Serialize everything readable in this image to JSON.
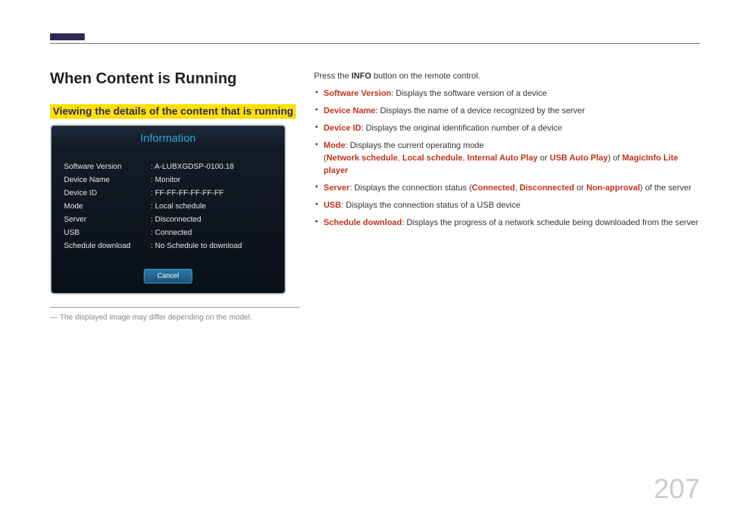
{
  "headings": {
    "h1": "When Content is Running",
    "h2": "Viewing the details of the content that is running"
  },
  "panel": {
    "title": "Information",
    "rows": [
      {
        "k": "Software Version",
        "v": "A-LUBXGDSP-0100.18"
      },
      {
        "k": "Device Name",
        "v": "Monitor"
      },
      {
        "k": "Device ID",
        "v": "FF-FF-FF-FF-FF-FF"
      },
      {
        "k": "Mode",
        "v": "Local schedule"
      },
      {
        "k": "Server",
        "v": "Disconnected"
      },
      {
        "k": "USB",
        "v": "Connected"
      },
      {
        "k": "Schedule download",
        "v": "No Schedule to download"
      }
    ],
    "cancel": "Cancel"
  },
  "note": "The displayed image may differ depending on the model.",
  "intro_pre": "Press the ",
  "intro_bold": "INFO",
  "intro_post": " button on the remote control.",
  "bullets": {
    "sv_term": "Software Version",
    "sv_desc": ": Displays the software version of a device",
    "dn_term": "Device Name",
    "dn_desc": ": Displays the name of a device recognized by the server",
    "di_term": "Device ID",
    "di_desc": ": Displays the original identification number of a device",
    "mode_term": "Mode",
    "mode_desc": ": Displays the current operating mode",
    "mode_paren_open": "(",
    "mode_net": "Network schedule",
    "mode_sep1": ", ",
    "mode_local": "Local schedule",
    "mode_sep2": ", ",
    "mode_internal": "Internal Auto Play",
    "mode_or": " or ",
    "mode_usb": "USB Auto Play",
    "mode_paren_close": ") of ",
    "mode_player": "MagicInfo Lite player",
    "server_term": "Server",
    "server_pre": ": Displays the connection status (",
    "server_connected": "Connected",
    "server_sep1": ", ",
    "server_disconnected": "Disconnected",
    "server_or": " or ",
    "server_nonapproval": "Non-approval",
    "server_post": ") of the server",
    "usb_term": "USB",
    "usb_desc": ": Displays the connection status of a USB device",
    "sd_term": "Schedule download",
    "sd_desc": ": Displays the progress of a network schedule being downloaded from the server"
  },
  "page_number": "207"
}
